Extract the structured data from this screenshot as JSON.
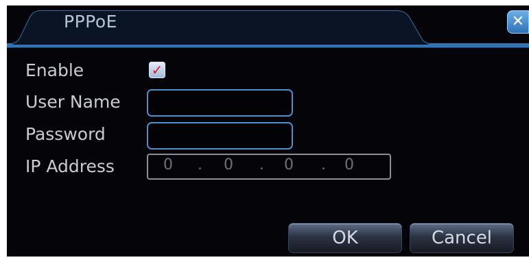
{
  "dialog": {
    "title": "PPPoE",
    "close_glyph": "✕"
  },
  "fields": {
    "enable_label": "Enable",
    "enable_checked": true,
    "username_label": "User Name",
    "username_value": "",
    "password_label": "Password",
    "password_value": "",
    "ip_label": "IP Address",
    "ip_octets": [
      "0",
      "0",
      "0",
      "0"
    ]
  },
  "buttons": {
    "ok_label": "OK",
    "cancel_label": "Cancel"
  },
  "colors": {
    "background": "#050509",
    "frame_blue": "#2f74b8",
    "label_text": "#c9ccd3",
    "check_mark": "#d21f1f"
  },
  "icons": {
    "close": "close-icon",
    "check": "checkmark-icon"
  }
}
